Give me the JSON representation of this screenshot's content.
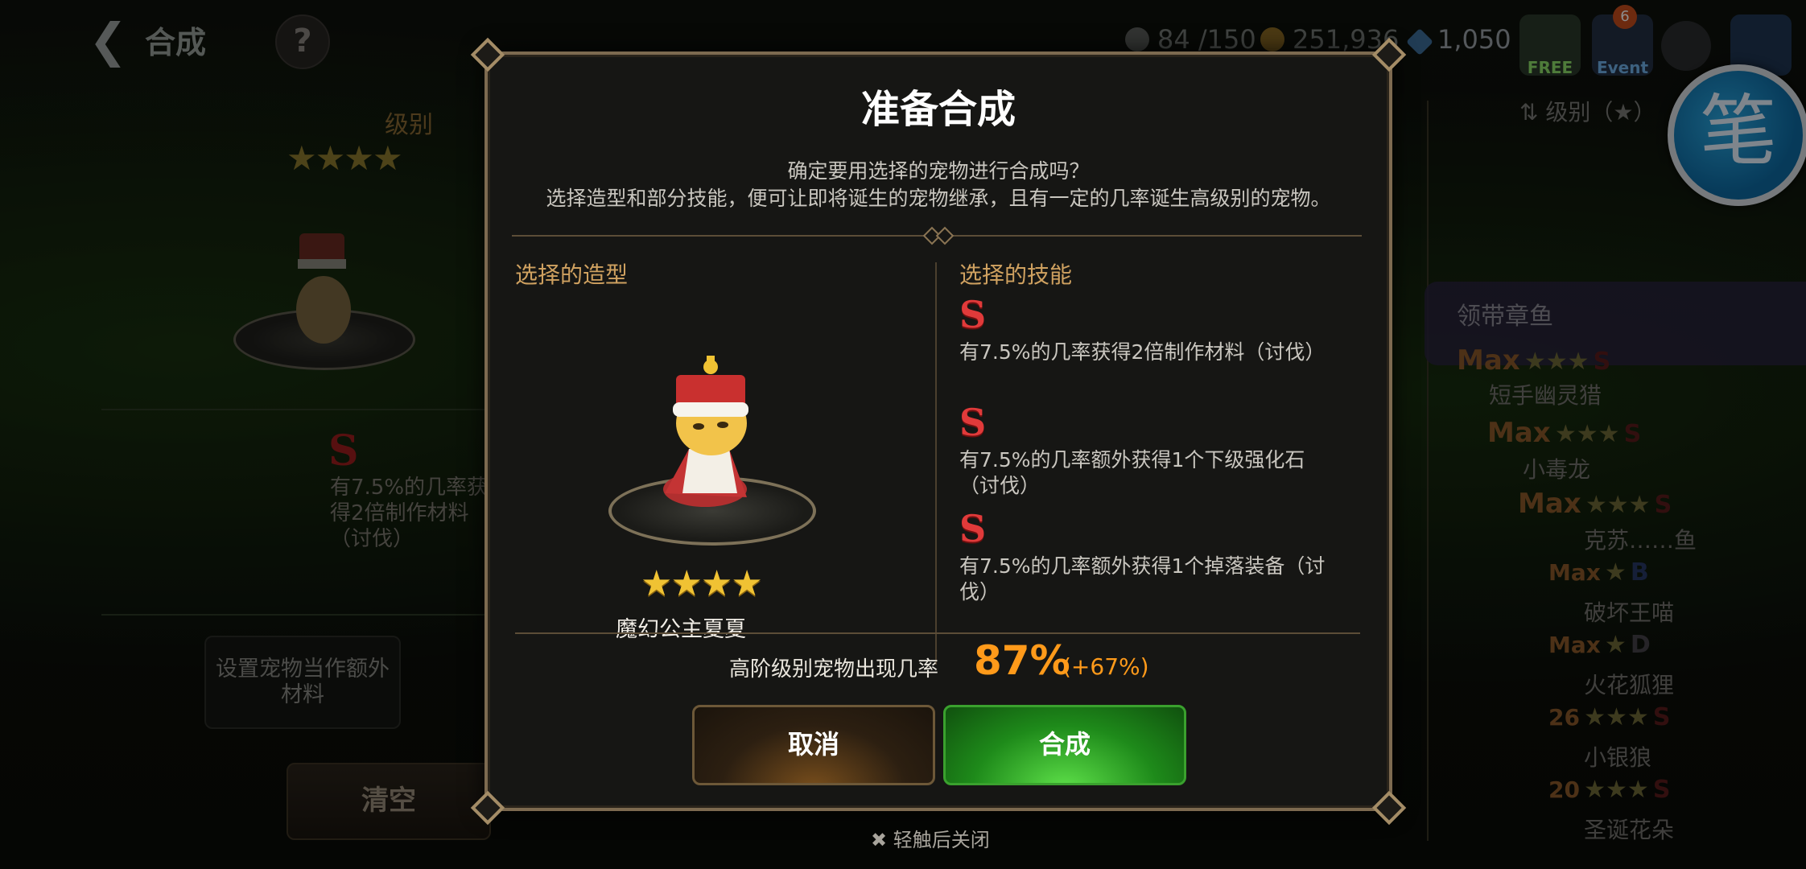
{
  "header": {
    "title": "合成",
    "help_label": "?",
    "resources": [
      {
        "icon": "pet-capacity-icon",
        "value": "84 /150"
      },
      {
        "icon": "gold-coin-icon",
        "value": "251,936"
      },
      {
        "icon": "gem-icon",
        "value": "1,050"
      }
    ],
    "icons": [
      {
        "icon": "free-gift-icon",
        "caption": "FREE"
      },
      {
        "icon": "event-mail-icon",
        "caption": "Event",
        "badge": "6"
      },
      {
        "icon": "chat-icon",
        "caption": ""
      },
      {
        "icon": "menu-grid-icon",
        "caption": ""
      }
    ],
    "brush_char": "笔"
  },
  "background": {
    "level_label": "级别",
    "stars": "★★★★",
    "skill_mark": "S",
    "skill_text": "有7.5%的几率获得2倍制作材料（讨伐）",
    "extra_material_label": "设置宠物当作额外材料",
    "clear_label": "清空",
    "sort_label": "级别（★）",
    "list": [
      {
        "name": "领带章鱼",
        "level": "Max",
        "stars": "★★★",
        "grade": "S"
      },
      {
        "name": "短手幽灵猎",
        "level": "Max",
        "stars": "★★★",
        "grade": "S"
      },
      {
        "name": "小毒龙",
        "level": "Max",
        "stars": "★★★",
        "grade": "S"
      },
      {
        "name": "克苏……鱼",
        "level": "Max",
        "stars": "★",
        "grade": "B"
      },
      {
        "name": "破坏王喵",
        "level": "Max",
        "stars": "★",
        "grade": "D"
      },
      {
        "name": "火花狐狸",
        "level": "26",
        "stars": "★★★",
        "grade": "S"
      },
      {
        "name": "小银狼",
        "level": "20",
        "stars": "★★★",
        "grade": "S"
      },
      {
        "name": "圣诞花朵",
        "level": "",
        "stars": "",
        "grade": ""
      }
    ]
  },
  "dialog": {
    "title": "准备合成",
    "desc_line1": "确定要用选择的宠物进行合成吗？",
    "desc_line2": "选择造型和部分技能，便可让即将诞生的宠物继承，且有一定的几率诞生高级别的宠物。",
    "left_heading": "选择的造型",
    "right_heading": "选择的技能",
    "pet": {
      "name": "魔幻公主夏夏",
      "stars": "★★★★"
    },
    "skills": [
      {
        "grade": "S",
        "text": "有7.5%的几率获得2倍制作材料（讨伐）"
      },
      {
        "grade": "S",
        "text": "有7.5%的几率额外获得1个下级强化石（讨伐）"
      },
      {
        "grade": "S",
        "text": "有7.5%的几率额外获得1个掉落装备（讨伐）"
      }
    ],
    "rate_label": "高阶级别宠物出现几率",
    "rate_value": "87%",
    "rate_increase": "(+67%)",
    "cancel_label": "取消",
    "confirm_label": "合成"
  },
  "close_hint": "轻触后关闭",
  "colors": {
    "accent_gold": "#cfa160",
    "rate_orange": "#ff9a1a",
    "confirm_green": "#2ea82a",
    "skill_red": "#e03a3a"
  }
}
